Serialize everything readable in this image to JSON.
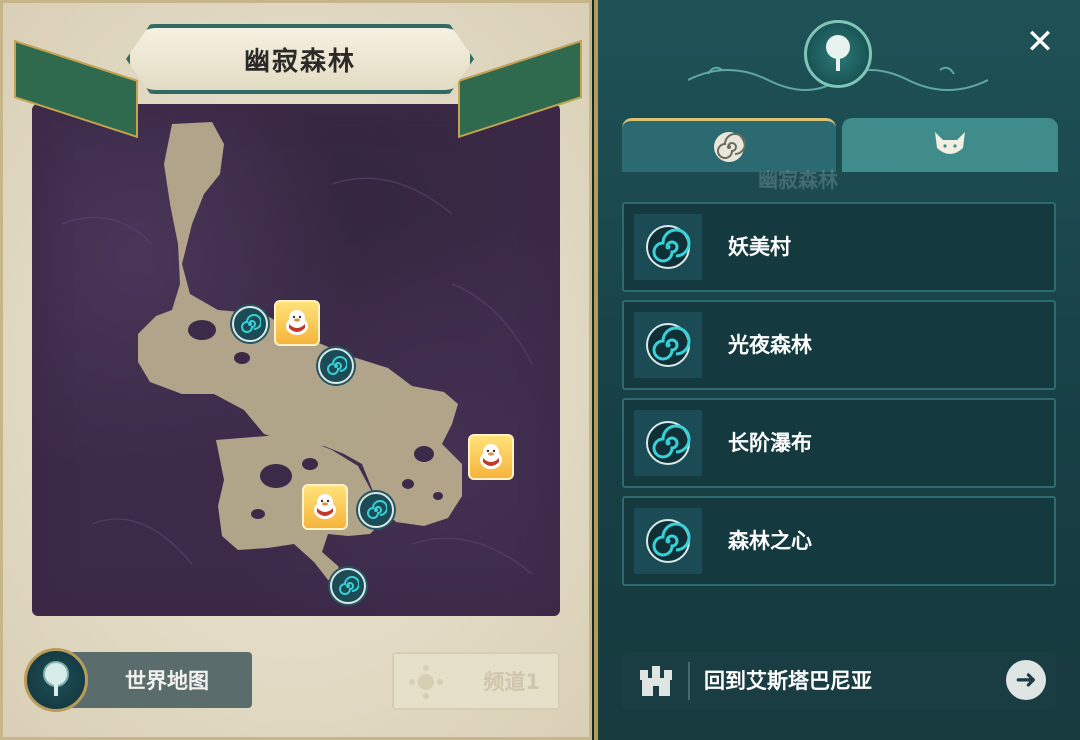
{
  "map": {
    "title": "幽寂森林",
    "world_map_label": "世界地图",
    "channel_label": "频道1",
    "colors": {
      "path": "#b7ab8d",
      "background": "#3b2a48",
      "portal": "#37d2d8"
    },
    "markers": [
      {
        "type": "portal-icon"
      },
      {
        "type": "npc-icon"
      },
      {
        "type": "portal-icon"
      },
      {
        "type": "npc-icon"
      },
      {
        "type": "npc-icon"
      },
      {
        "type": "portal-icon"
      },
      {
        "type": "portal-icon"
      }
    ]
  },
  "panel": {
    "close_label": "✕",
    "tabs": [
      {
        "icon": "portal-swirl-icon",
        "selected": true
      },
      {
        "icon": "fox-icon",
        "selected": false
      }
    ],
    "locations": [
      {
        "name": "妖美村",
        "icon": "portal-swirl-icon"
      },
      {
        "name": "光夜森林",
        "icon": "portal-swirl-icon"
      },
      {
        "name": "长阶瀑布",
        "icon": "portal-swirl-icon"
      },
      {
        "name": "森林之心",
        "icon": "portal-swirl-icon"
      }
    ],
    "return_label": "回到艾斯塔巴尼亚",
    "return_arrow": "➜",
    "accent": "#d9c274"
  }
}
